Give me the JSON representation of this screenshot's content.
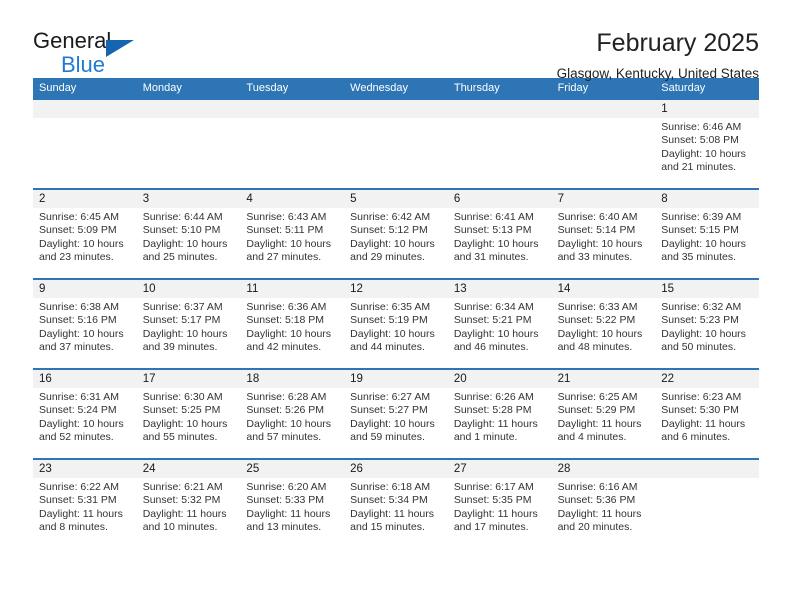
{
  "branding": {
    "name_part1": "General",
    "name_part2": "Blue",
    "triangle_color": "#1565b0",
    "blue_text_color": "#1f7ad4"
  },
  "header": {
    "title": "February 2025",
    "subtitle": "Glasgow, Kentucky, United States",
    "header_bg_color": "#2e75b6",
    "daynum_band_color": "#f2f2f2"
  },
  "weekdays": [
    "Sunday",
    "Monday",
    "Tuesday",
    "Wednesday",
    "Thursday",
    "Friday",
    "Saturday"
  ],
  "weeks": [
    {
      "days": [
        {
          "num": "",
          "sunrise": "",
          "sunset": "",
          "daylight": "",
          "empty": true
        },
        {
          "num": "",
          "sunrise": "",
          "sunset": "",
          "daylight": "",
          "empty": true
        },
        {
          "num": "",
          "sunrise": "",
          "sunset": "",
          "daylight": "",
          "empty": true
        },
        {
          "num": "",
          "sunrise": "",
          "sunset": "",
          "daylight": "",
          "empty": true
        },
        {
          "num": "",
          "sunrise": "",
          "sunset": "",
          "daylight": "",
          "empty": true
        },
        {
          "num": "",
          "sunrise": "",
          "sunset": "",
          "daylight": "",
          "empty": true
        },
        {
          "num": "1",
          "sunrise": "Sunrise: 6:46 AM",
          "sunset": "Sunset: 5:08 PM",
          "daylight": "Daylight: 10 hours and 21 minutes."
        }
      ]
    },
    {
      "days": [
        {
          "num": "2",
          "sunrise": "Sunrise: 6:45 AM",
          "sunset": "Sunset: 5:09 PM",
          "daylight": "Daylight: 10 hours and 23 minutes."
        },
        {
          "num": "3",
          "sunrise": "Sunrise: 6:44 AM",
          "sunset": "Sunset: 5:10 PM",
          "daylight": "Daylight: 10 hours and 25 minutes."
        },
        {
          "num": "4",
          "sunrise": "Sunrise: 6:43 AM",
          "sunset": "Sunset: 5:11 PM",
          "daylight": "Daylight: 10 hours and 27 minutes."
        },
        {
          "num": "5",
          "sunrise": "Sunrise: 6:42 AM",
          "sunset": "Sunset: 5:12 PM",
          "daylight": "Daylight: 10 hours and 29 minutes."
        },
        {
          "num": "6",
          "sunrise": "Sunrise: 6:41 AM",
          "sunset": "Sunset: 5:13 PM",
          "daylight": "Daylight: 10 hours and 31 minutes."
        },
        {
          "num": "7",
          "sunrise": "Sunrise: 6:40 AM",
          "sunset": "Sunset: 5:14 PM",
          "daylight": "Daylight: 10 hours and 33 minutes."
        },
        {
          "num": "8",
          "sunrise": "Sunrise: 6:39 AM",
          "sunset": "Sunset: 5:15 PM",
          "daylight": "Daylight: 10 hours and 35 minutes."
        }
      ]
    },
    {
      "days": [
        {
          "num": "9",
          "sunrise": "Sunrise: 6:38 AM",
          "sunset": "Sunset: 5:16 PM",
          "daylight": "Daylight: 10 hours and 37 minutes."
        },
        {
          "num": "10",
          "sunrise": "Sunrise: 6:37 AM",
          "sunset": "Sunset: 5:17 PM",
          "daylight": "Daylight: 10 hours and 39 minutes."
        },
        {
          "num": "11",
          "sunrise": "Sunrise: 6:36 AM",
          "sunset": "Sunset: 5:18 PM",
          "daylight": "Daylight: 10 hours and 42 minutes."
        },
        {
          "num": "12",
          "sunrise": "Sunrise: 6:35 AM",
          "sunset": "Sunset: 5:19 PM",
          "daylight": "Daylight: 10 hours and 44 minutes."
        },
        {
          "num": "13",
          "sunrise": "Sunrise: 6:34 AM",
          "sunset": "Sunset: 5:21 PM",
          "daylight": "Daylight: 10 hours and 46 minutes."
        },
        {
          "num": "14",
          "sunrise": "Sunrise: 6:33 AM",
          "sunset": "Sunset: 5:22 PM",
          "daylight": "Daylight: 10 hours and 48 minutes."
        },
        {
          "num": "15",
          "sunrise": "Sunrise: 6:32 AM",
          "sunset": "Sunset: 5:23 PM",
          "daylight": "Daylight: 10 hours and 50 minutes."
        }
      ]
    },
    {
      "days": [
        {
          "num": "16",
          "sunrise": "Sunrise: 6:31 AM",
          "sunset": "Sunset: 5:24 PM",
          "daylight": "Daylight: 10 hours and 52 minutes."
        },
        {
          "num": "17",
          "sunrise": "Sunrise: 6:30 AM",
          "sunset": "Sunset: 5:25 PM",
          "daylight": "Daylight: 10 hours and 55 minutes."
        },
        {
          "num": "18",
          "sunrise": "Sunrise: 6:28 AM",
          "sunset": "Sunset: 5:26 PM",
          "daylight": "Daylight: 10 hours and 57 minutes."
        },
        {
          "num": "19",
          "sunrise": "Sunrise: 6:27 AM",
          "sunset": "Sunset: 5:27 PM",
          "daylight": "Daylight: 10 hours and 59 minutes."
        },
        {
          "num": "20",
          "sunrise": "Sunrise: 6:26 AM",
          "sunset": "Sunset: 5:28 PM",
          "daylight": "Daylight: 11 hours and 1 minute."
        },
        {
          "num": "21",
          "sunrise": "Sunrise: 6:25 AM",
          "sunset": "Sunset: 5:29 PM",
          "daylight": "Daylight: 11 hours and 4 minutes."
        },
        {
          "num": "22",
          "sunrise": "Sunrise: 6:23 AM",
          "sunset": "Sunset: 5:30 PM",
          "daylight": "Daylight: 11 hours and 6 minutes."
        }
      ]
    },
    {
      "days": [
        {
          "num": "23",
          "sunrise": "Sunrise: 6:22 AM",
          "sunset": "Sunset: 5:31 PM",
          "daylight": "Daylight: 11 hours and 8 minutes."
        },
        {
          "num": "24",
          "sunrise": "Sunrise: 6:21 AM",
          "sunset": "Sunset: 5:32 PM",
          "daylight": "Daylight: 11 hours and 10 minutes."
        },
        {
          "num": "25",
          "sunrise": "Sunrise: 6:20 AM",
          "sunset": "Sunset: 5:33 PM",
          "daylight": "Daylight: 11 hours and 13 minutes."
        },
        {
          "num": "26",
          "sunrise": "Sunrise: 6:18 AM",
          "sunset": "Sunset: 5:34 PM",
          "daylight": "Daylight: 11 hours and 15 minutes."
        },
        {
          "num": "27",
          "sunrise": "Sunrise: 6:17 AM",
          "sunset": "Sunset: 5:35 PM",
          "daylight": "Daylight: 11 hours and 17 minutes."
        },
        {
          "num": "28",
          "sunrise": "Sunrise: 6:16 AM",
          "sunset": "Sunset: 5:36 PM",
          "daylight": "Daylight: 11 hours and 20 minutes."
        },
        {
          "num": "",
          "sunrise": "",
          "sunset": "",
          "daylight": "",
          "empty": true
        }
      ]
    }
  ]
}
